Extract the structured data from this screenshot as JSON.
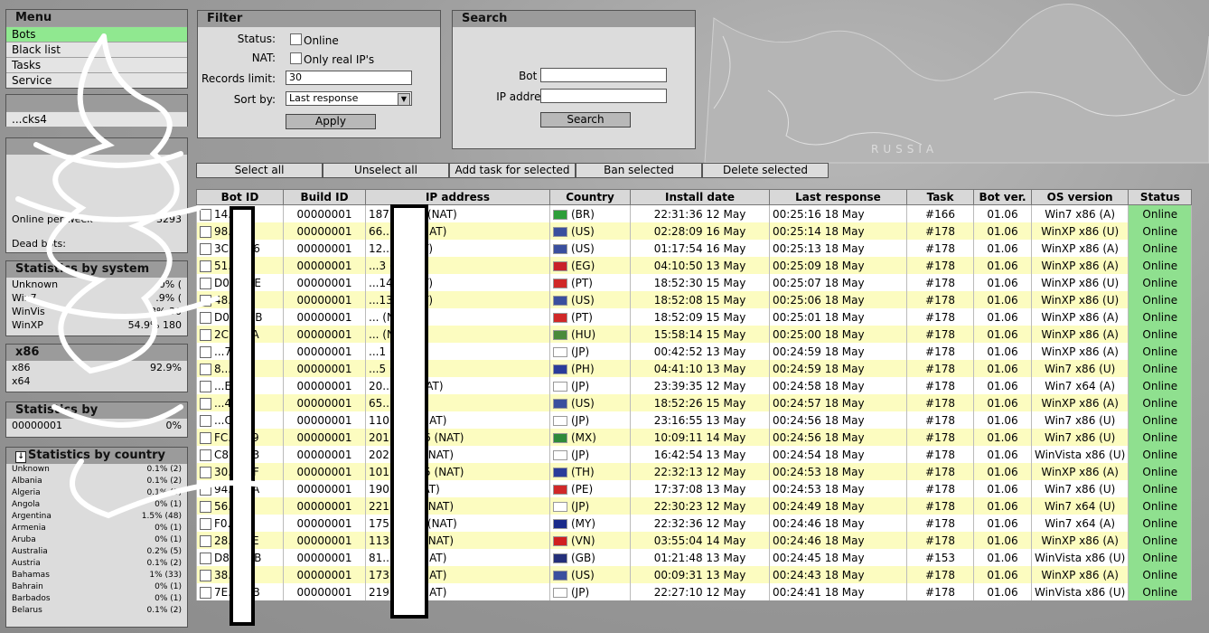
{
  "map": {
    "label": "RUSSIA"
  },
  "menu": {
    "title": "Menu",
    "items": [
      {
        "label": "Bots",
        "active": true
      },
      {
        "label": "Black list",
        "active": false
      },
      {
        "label": "Tasks",
        "active": false
      },
      {
        "label": "Service",
        "active": false
      }
    ]
  },
  "socks": {
    "item": "...cks4"
  },
  "common_stats": {
    "rows": [
      {
        "label": "Online per week",
        "value": "3293"
      },
      {
        "label": "Dead bots:",
        "value": ""
      }
    ]
  },
  "system_stats": {
    "title": "Statistics by system",
    "rows": [
      {
        "label": "Unknown",
        "value": "0% ("
      },
      {
        "label": "Win7",
        "value": ".9% ("
      },
      {
        "label": "WinVis",
        "value": "...3% 30"
      },
      {
        "label": "WinXP",
        "value": "54.9% 180"
      }
    ]
  },
  "arch_stats": {
    "title": "x86",
    "rows": [
      {
        "label": "x86",
        "value": "92.9%"
      },
      {
        "label": "x64",
        "value": ""
      }
    ]
  },
  "build_stats": {
    "title": "Statistics by",
    "rows": [
      {
        "label": "00000001",
        "value": "0%"
      }
    ]
  },
  "country_stats": {
    "title": "Statistics by country",
    "rows": [
      {
        "label": "Unknown",
        "value": "0.1% (2)"
      },
      {
        "label": "Albania",
        "value": "0.1% (2)"
      },
      {
        "label": "Algeria",
        "value": "0.1% (3)"
      },
      {
        "label": "Angola",
        "value": "0% (1)"
      },
      {
        "label": "Argentina",
        "value": "1.5% (48)"
      },
      {
        "label": "Armenia",
        "value": "0% (1)"
      },
      {
        "label": "Aruba",
        "value": "0% (1)"
      },
      {
        "label": "Australia",
        "value": "0.2% (5)"
      },
      {
        "label": "Austria",
        "value": "0.1% (2)"
      },
      {
        "label": "Bahamas",
        "value": "1% (33)"
      },
      {
        "label": "Bahrain",
        "value": "0% (1)"
      },
      {
        "label": "Barbados",
        "value": "0% (1)"
      },
      {
        "label": "Belarus",
        "value": "0.1% (2)"
      }
    ]
  },
  "filter": {
    "title": "Filter",
    "status_label": "Status:",
    "online_label": "Online",
    "nat_label": "NAT:",
    "real_ip_label": "Only real IP's",
    "records_label": "Records limit:",
    "records_value": "30",
    "sort_label": "Sort by:",
    "sort_value": "Last response",
    "apply_label": "Apply"
  },
  "search": {
    "title": "Search",
    "bot_id_label": "Bot ID:",
    "ip_label": "IP address:",
    "button_label": "Search"
  },
  "actions": {
    "select_all": "Select all",
    "unselect_all": "Unselect all",
    "add_task": "Add task for selected",
    "ban": "Ban selected",
    "delete": "Delete selected"
  },
  "table": {
    "headers": [
      "Bot ID",
      "Build ID",
      "IP address",
      "Country",
      "Install date",
      "Last response",
      "Task",
      "Bot ver.",
      "OS version",
      "Status"
    ],
    "rows": [
      {
        "id": "14...AA",
        "build": "00000001",
        "ip": "187...9.83 (NAT)",
        "cc": "(BR)",
        "flag": "#2e9e3a",
        "install": "22:31:36 12 May",
        "last": "00:25:16 18 May",
        "task": "#166",
        "ver": "01.06",
        "os": "Win7 x86 (A)",
        "status": "Online"
      },
      {
        "id": "98...F7",
        "build": "00000001",
        "ip": "66...159 (NAT)",
        "cc": "(US)",
        "flag": "#3a4f9e",
        "install": "02:28:09 16 May",
        "last": "00:25:14 18 May",
        "task": "#178",
        "ver": "01.06",
        "os": "WinXP x86 (U)",
        "status": "Online"
      },
      {
        "id": "3C...A66",
        "build": "00000001",
        "ip": "12...3 (NAT)",
        "cc": "(US)",
        "flag": "#3a4f9e",
        "install": "01:17:54 16 May",
        "last": "00:25:13 18 May",
        "task": "#178",
        "ver": "01.06",
        "os": "WinXP x86 (A)",
        "status": "Online"
      },
      {
        "id": "51...C9",
        "build": "00000001",
        "ip": "...3 (NAT)",
        "cc": "(EG)",
        "flag": "#c8202a",
        "install": "04:10:50 13 May",
        "last": "00:25:09 18 May",
        "task": "#178",
        "ver": "01.06",
        "os": "WinXP x86 (A)",
        "status": "Online"
      },
      {
        "id": "D0...C1E",
        "build": "00000001",
        "ip": "...144 (NAT)",
        "cc": "(PT)",
        "flag": "#d02828",
        "install": "18:52:30 15 May",
        "last": "00:25:07 18 May",
        "task": "#178",
        "ver": "01.06",
        "os": "WinXP x86 (U)",
        "status": "Online"
      },
      {
        "id": "48...BB",
        "build": "00000001",
        "ip": "...138 (NAT)",
        "cc": "(US)",
        "flag": "#3a4f9e",
        "install": "18:52:08 15 May",
        "last": "00:25:06 18 May",
        "task": "#178",
        "ver": "01.06",
        "os": "WinXP x86 (U)",
        "status": "Online"
      },
      {
        "id": "D0...D5B",
        "build": "00000001",
        "ip": "... (NAT)",
        "cc": "(PT)",
        "flag": "#d02828",
        "install": "18:52:09 15 May",
        "last": "00:25:01 18 May",
        "task": "#178",
        "ver": "01.06",
        "os": "WinXP x86 (A)",
        "status": "Online"
      },
      {
        "id": "2C...BFA",
        "build": "00000001",
        "ip": "... (NAT)",
        "cc": "(HU)",
        "flag": "#4a8a3a",
        "install": "15:58:14 15 May",
        "last": "00:25:00 18 May",
        "task": "#178",
        "ver": "01.06",
        "os": "WinXP x86 (A)",
        "status": "Online"
      },
      {
        "id": "...755",
        "build": "00000001",
        "ip": "...1 (NAT)",
        "cc": "(JP)",
        "flag": "#ffffff",
        "install": "00:42:52 13 May",
        "last": "00:24:59 18 May",
        "task": "#178",
        "ver": "01.06",
        "os": "WinXP x86 (A)",
        "status": "Online"
      },
      {
        "id": "8...959",
        "build": "00000001",
        "ip": "...5 (NAT)",
        "cc": "(PH)",
        "flag": "#2a3c9a",
        "install": "04:41:10 13 May",
        "last": "00:24:59 18 May",
        "task": "#178",
        "ver": "01.06",
        "os": "Win7 x86 (U)",
        "status": "Online"
      },
      {
        "id": "...E29",
        "build": "00000001",
        "ip": "20...4.1 (NAT)",
        "cc": "(JP)",
        "flag": "#ffffff",
        "install": "23:39:35 12 May",
        "last": "00:24:58 18 May",
        "task": "#178",
        "ver": "01.06",
        "os": "Win7 x64 (A)",
        "status": "Online"
      },
      {
        "id": "...461",
        "build": "00000001",
        "ip": "65... (NAT)",
        "cc": "(US)",
        "flag": "#3a4f9e",
        "install": "18:52:26 15 May",
        "last": "00:24:57 18 May",
        "task": "#178",
        "ver": "01.06",
        "os": "WinXP x86 (A)",
        "status": "Online"
      },
      {
        "id": "...C90",
        "build": "00000001",
        "ip": "110...50 (NAT)",
        "cc": "(JP)",
        "flag": "#ffffff",
        "install": "23:16:55 13 May",
        "last": "00:24:56 18 May",
        "task": "#178",
        "ver": "01.06",
        "os": "Win7 x86 (U)",
        "status": "Online"
      },
      {
        "id": "FC...489",
        "build": "00000001",
        "ip": "201...6.146 (NAT)",
        "cc": "(MX)",
        "flag": "#2e8a3a",
        "install": "10:09:11 14 May",
        "last": "00:24:56 18 May",
        "task": "#178",
        "ver": "01.06",
        "os": "Win7 x86 (U)",
        "status": "Online"
      },
      {
        "id": "C8...E33",
        "build": "00000001",
        "ip": "202...162 (NAT)",
        "cc": "(JP)",
        "flag": "#ffffff",
        "install": "16:42:54 13 May",
        "last": "00:24:54 18 May",
        "task": "#178",
        "ver": "01.06",
        "os": "WinVista x86 (U)",
        "status": "Online"
      },
      {
        "id": "30...DFF",
        "build": "00000001",
        "ip": "101...6.125 (NAT)",
        "cc": "(TH)",
        "flag": "#2a3c9a",
        "install": "22:32:13 12 May",
        "last": "00:24:53 18 May",
        "task": "#178",
        "ver": "01.06",
        "os": "WinXP x86 (A)",
        "status": "Online"
      },
      {
        "id": "94...20A",
        "build": "00000001",
        "ip": "190...3 (NAT)",
        "cc": "(PE)",
        "flag": "#d02828",
        "install": "17:37:08 13 May",
        "last": "00:24:53 18 May",
        "task": "#178",
        "ver": "01.06",
        "os": "Win7 x86 (U)",
        "status": "Online"
      },
      {
        "id": "56...CF",
        "build": "00000001",
        "ip": "221...214 (NAT)",
        "cc": "(JP)",
        "flag": "#ffffff",
        "install": "22:30:23 12 May",
        "last": "00:24:49 18 May",
        "task": "#178",
        "ver": "01.06",
        "os": "Win7 x64 (U)",
        "status": "Online"
      },
      {
        "id": "F0...86",
        "build": "00000001",
        "ip": "175...5.14 (NAT)",
        "cc": "(MY)",
        "flag": "#1a2a8a",
        "install": "22:32:36 12 May",
        "last": "00:24:46 18 May",
        "task": "#178",
        "ver": "01.06",
        "os": "Win7 x64 (A)",
        "status": "Online"
      },
      {
        "id": "28...91E",
        "build": "00000001",
        "ip": "113...129 (NAT)",
        "cc": "(VN)",
        "flag": "#d02020",
        "install": "03:55:04 14 May",
        "last": "00:24:46 18 May",
        "task": "#178",
        "ver": "01.06",
        "os": "WinXP x86 (A)",
        "status": "Online"
      },
      {
        "id": "D8...B3B",
        "build": "00000001",
        "ip": "81...108 (NAT)",
        "cc": "(GB)",
        "flag": "#24307a",
        "install": "01:21:48 13 May",
        "last": "00:24:45 18 May",
        "task": "#153",
        "ver": "01.06",
        "os": "WinVista x86 (U)",
        "status": "Online"
      },
      {
        "id": "38...B3",
        "build": "00000001",
        "ip": "173...16 (NAT)",
        "cc": "(US)",
        "flag": "#3a4f9e",
        "install": "00:09:31 13 May",
        "last": "00:24:43 18 May",
        "task": "#178",
        "ver": "01.06",
        "os": "WinXP x86 (A)",
        "status": "Online"
      },
      {
        "id": "7E...9AB",
        "build": "00000001",
        "ip": "219...19 (NAT)",
        "cc": "(JP)",
        "flag": "#ffffff",
        "install": "22:27:10 12 May",
        "last": "00:24:41 18 May",
        "task": "#178",
        "ver": "01.06",
        "os": "WinVista x86 (U)",
        "status": "Online"
      }
    ]
  }
}
